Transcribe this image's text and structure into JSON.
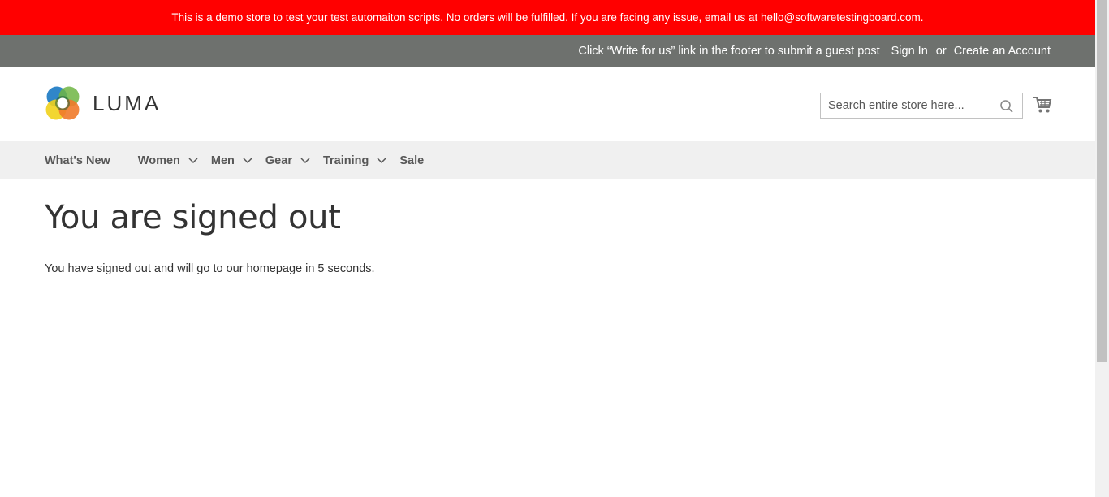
{
  "notice": {
    "text": "This is a demo store to test your test automaiton scripts. No orders will be fulfilled. If you are facing any issue, email us at hello@softwaretestingboard.com."
  },
  "topbar": {
    "guest_post": "Click “Write for us” link in the footer to submit a guest post",
    "sign_in": "Sign In",
    "or": "or",
    "create_account": "Create an Account"
  },
  "header": {
    "logo_text": "LUMA",
    "search_placeholder": "Search entire store here...",
    "search_icon": "search-icon",
    "cart_icon": "cart-icon"
  },
  "nav": {
    "items": [
      {
        "label": "What's New",
        "has_dropdown": false
      },
      {
        "label": "Women",
        "has_dropdown": true
      },
      {
        "label": "Men",
        "has_dropdown": true
      },
      {
        "label": "Gear",
        "has_dropdown": true
      },
      {
        "label": "Training",
        "has_dropdown": true
      },
      {
        "label": "Sale",
        "has_dropdown": false
      }
    ]
  },
  "main": {
    "title": "You are signed out",
    "message": "You have signed out and will go to our homepage in 5 seconds."
  },
  "colors": {
    "notice_bg": "#ff0000",
    "topbar_bg": "#6e716e",
    "nav_bg": "#f0f0f0"
  }
}
